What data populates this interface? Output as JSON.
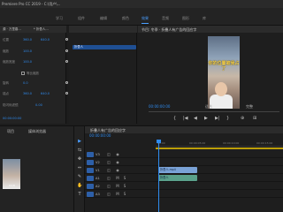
{
  "app": {
    "title": "Premiere Pro CC 2019 - C:\\用户\\..."
  },
  "workspaces": [
    "学习",
    "组件",
    "编辑",
    "颜色",
    "效果",
    "音频",
    "图形",
    "库"
  ],
  "active_workspace_index": 4,
  "effect_controls": {
    "source_label": "源 · 万里春…",
    "clip_label": "* 折叠人...",
    "rows": [
      {
        "label": "位置",
        "values": [
          "360.0",
          "640.0"
        ]
      },
      {
        "label": "缩放",
        "values": [
          "100.0"
        ]
      },
      {
        "label": "缩放宽度",
        "values": [
          "100.0"
        ]
      },
      {
        "label": "等比缩放",
        "checked": true
      },
      {
        "label": "旋转",
        "values": [
          "0.0"
        ]
      },
      {
        "label": "锚点",
        "values": [
          "360.0",
          "640.0"
        ]
      },
      {
        "label": "防闪烁滤镜",
        "values": [
          "0.00"
        ]
      }
    ],
    "timecode": "00:00:00:00"
  },
  "ec_timeline": {
    "clip_label": "折叠人"
  },
  "program_monitor": {
    "title": "节目: 冬季 · 折叠人有广告的回应字",
    "caption": "你的位置被我占了",
    "timecode": "00:00:00:00",
    "fit": "适合",
    "resolution": "完整",
    "controls": [
      "{",
      "|◀",
      "◀",
      "▶",
      "▶|",
      "}",
      "⊕",
      "⊞"
    ]
  },
  "project_panel": {
    "tabs": [
      "项目",
      "媒体浏览器"
    ],
    "thumb_duration": "0:18"
  },
  "tools": [
    "▶",
    "⇆",
    "✥",
    "⇔",
    "✎",
    "✋",
    "T"
  ],
  "active_tool_index": 0,
  "timeline": {
    "title": "折叠人有广告的回应字",
    "timecode": "00:00:00:00",
    "ruler_ticks": [
      "00:00",
      "00:00:05:00",
      "00:00:10:00",
      "00:00:15:00"
    ],
    "tracks": [
      {
        "name": "V3",
        "kind": "v"
      },
      {
        "name": "V2",
        "kind": "v"
      },
      {
        "name": "V1",
        "kind": "v",
        "clip": "折叠人.mp4"
      },
      {
        "name": "A1",
        "kind": "a",
        "clip": "折叠人"
      },
      {
        "name": "A2",
        "kind": "a"
      },
      {
        "name": "A3",
        "kind": "a"
      }
    ]
  },
  "colors": {
    "accent": "#2f8cf0",
    "video_clip": "#7aa2d6",
    "audio_clip": "#5aa08a",
    "work_bar": "#ffd400"
  }
}
